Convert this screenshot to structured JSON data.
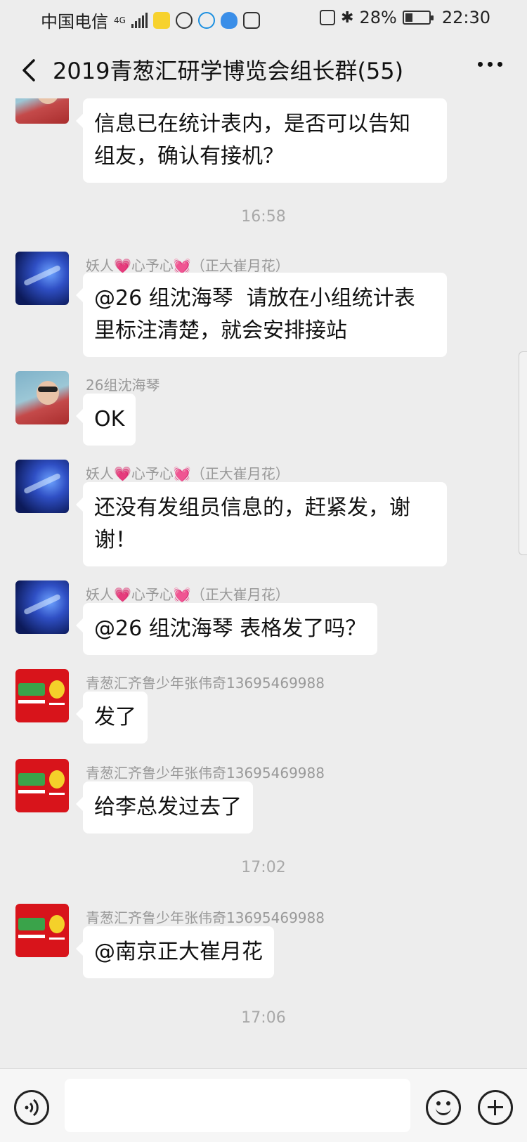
{
  "status_bar": {
    "carrier": "中国电信",
    "network": "4G",
    "battery": "28%",
    "battery_level": 0.28,
    "time": "22:30"
  },
  "header": {
    "title": "2019青葱汇研学博览会组长群(55)"
  },
  "messages": [
    {
      "text": "信息已在统计表内，是否可以告知\n组友，确认有接机？"
    },
    {
      "time": "16:58"
    },
    {
      "sender": "妖人💗心予心💓（正大崔月花）",
      "text": "@26 组沈海琴  请放在小组统计表\n里标注清楚，就会安排接站"
    },
    {
      "sender": "26组沈海琴",
      "text": "OK"
    },
    {
      "sender": "妖人💗心予心💓（正大崔月花）",
      "text": "还没有发组员信息的，赶紧发，谢\n谢！"
    },
    {
      "sender": "妖人💗心予心💓（正大崔月花）",
      "text": "@26 组沈海琴  表格发了吗？"
    },
    {
      "sender": "青葱汇齐鲁少年张伟奇13695469988",
      "text": "发了"
    },
    {
      "sender": "青葱汇齐鲁少年张伟奇13695469988",
      "text": "给李总发过去了"
    },
    {
      "time": "17:02"
    },
    {
      "sender": "青葱汇齐鲁少年张伟奇13695469988",
      "text": "@南京正大崔月花"
    },
    {
      "time": "17:06"
    }
  ],
  "input_bar": {
    "icons": [
      "voice-icon",
      "emoji-icon",
      "plus-icon"
    ]
  },
  "colors": {
    "background": "#ededed",
    "bubble": "#ffffff",
    "sender_text": "#999999",
    "timestamp": "#a8a8a8"
  }
}
